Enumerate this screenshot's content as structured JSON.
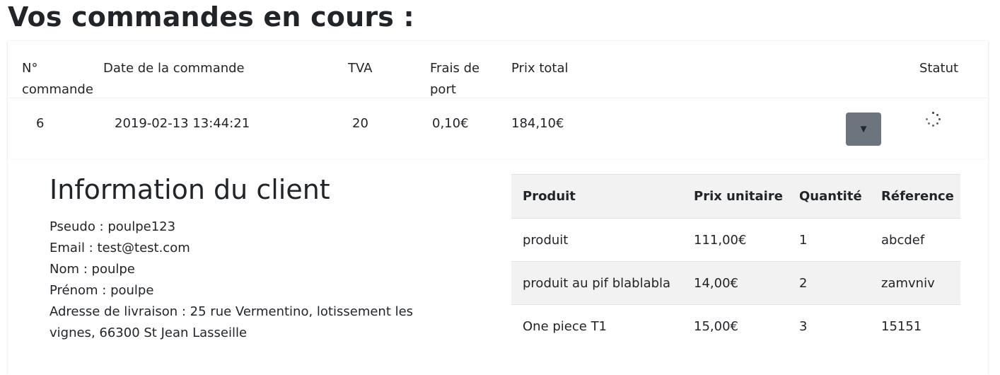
{
  "page": {
    "title": "Vos commandes en cours :"
  },
  "orders": {
    "headers": {
      "num": "N° commande",
      "date": "Date de la commande",
      "tva": "TVA",
      "frais": "Frais de port",
      "total": "Prix total",
      "statut": "Statut"
    },
    "row": {
      "num": "6",
      "date": "2019-02-13 13:44:21",
      "tva": "20",
      "frais": "0,10€",
      "total": "184,10€",
      "toggle_icon": "caret-down-icon",
      "status_icon": "loading-spinner-icon"
    }
  },
  "client": {
    "title": "Information du client",
    "pseudo": "Pseudo : poulpe123",
    "email": "Email : test@test.com",
    "nom": "Nom : poulpe",
    "prenom": "Prénom : poulpe",
    "adresse": "Adresse de livraison : 25 rue Vermentino, lotissement les vignes, 66300 St Jean Lasseille"
  },
  "products": {
    "headers": [
      "Produit",
      "Prix unitaire",
      "Quantité",
      "Réference"
    ],
    "rows": [
      [
        "produit",
        "111,00€",
        "1",
        "abcdef"
      ],
      [
        "produit au pif blablabla",
        "14,00€",
        "2",
        "zamvniv"
      ],
      [
        "One piece T1",
        "15,00€",
        "3",
        "15151"
      ]
    ]
  },
  "colors": {
    "button_bg": "#6c757d",
    "striped_row": "#f2f2f2"
  }
}
